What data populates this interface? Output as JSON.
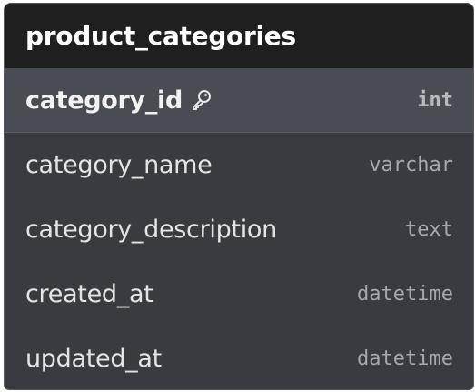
{
  "table": {
    "title": "product_categories",
    "columns": [
      {
        "name": "category_id",
        "type": "int",
        "primary_key": true,
        "icon": "key-icon"
      },
      {
        "name": "category_name",
        "type": "varchar",
        "primary_key": false
      },
      {
        "name": "category_description",
        "type": "text",
        "primary_key": false
      },
      {
        "name": "created_at",
        "type": "datetime",
        "primary_key": false
      },
      {
        "name": "updated_at",
        "type": "datetime",
        "primary_key": false
      }
    ]
  },
  "colors": {
    "header_bg": "#1f1f1f",
    "body_bg": "#3a3b41",
    "pk_row_bg": "#4a4c54",
    "text": "#e4e4e6",
    "type_text": "#a7a8ad"
  }
}
